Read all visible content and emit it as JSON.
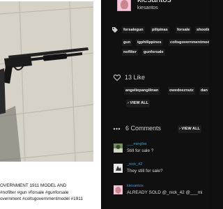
{
  "post": {
    "caption_lines": [
      "OVERNMENT 1911 MODEL AND",
      "#nofilter #gun #forsale #gunforsale",
      "overnment #coltsgovernmentmodel #1911"
    ]
  },
  "user": {
    "name": "kiesantos",
    "handle": "kiesantos"
  },
  "tags": [
    "forsalegun",
    "pilipinas",
    "forsale",
    "shooting",
    "gun",
    "igphilippines",
    "coltsgovernmentmodel",
    "nofilter",
    "gunforsale"
  ],
  "likes": {
    "label": "13 Like",
    "users": [
      "angeliepangilinan",
      "owedeeznutz",
      "dan"
    ],
    "view_all": "› VIEW ALL"
  },
  "comments": {
    "label": "6 Comments",
    "view_all": "› VIEW ALL",
    "items": [
      {
        "user": "___minglos",
        "text": "Still for sale ?"
      },
      {
        "user": "_nick_42",
        "text": "They still for sale?"
      },
      {
        "user": "kiesantos",
        "text": "ALREADY SOLD @_nick_42 @___mi"
      }
    ]
  },
  "colors": {
    "background": "#101010",
    "tag_bg": "#1c1c1c",
    "link": "#3aa0d8",
    "avatar_pink": "#f2c6d8"
  }
}
